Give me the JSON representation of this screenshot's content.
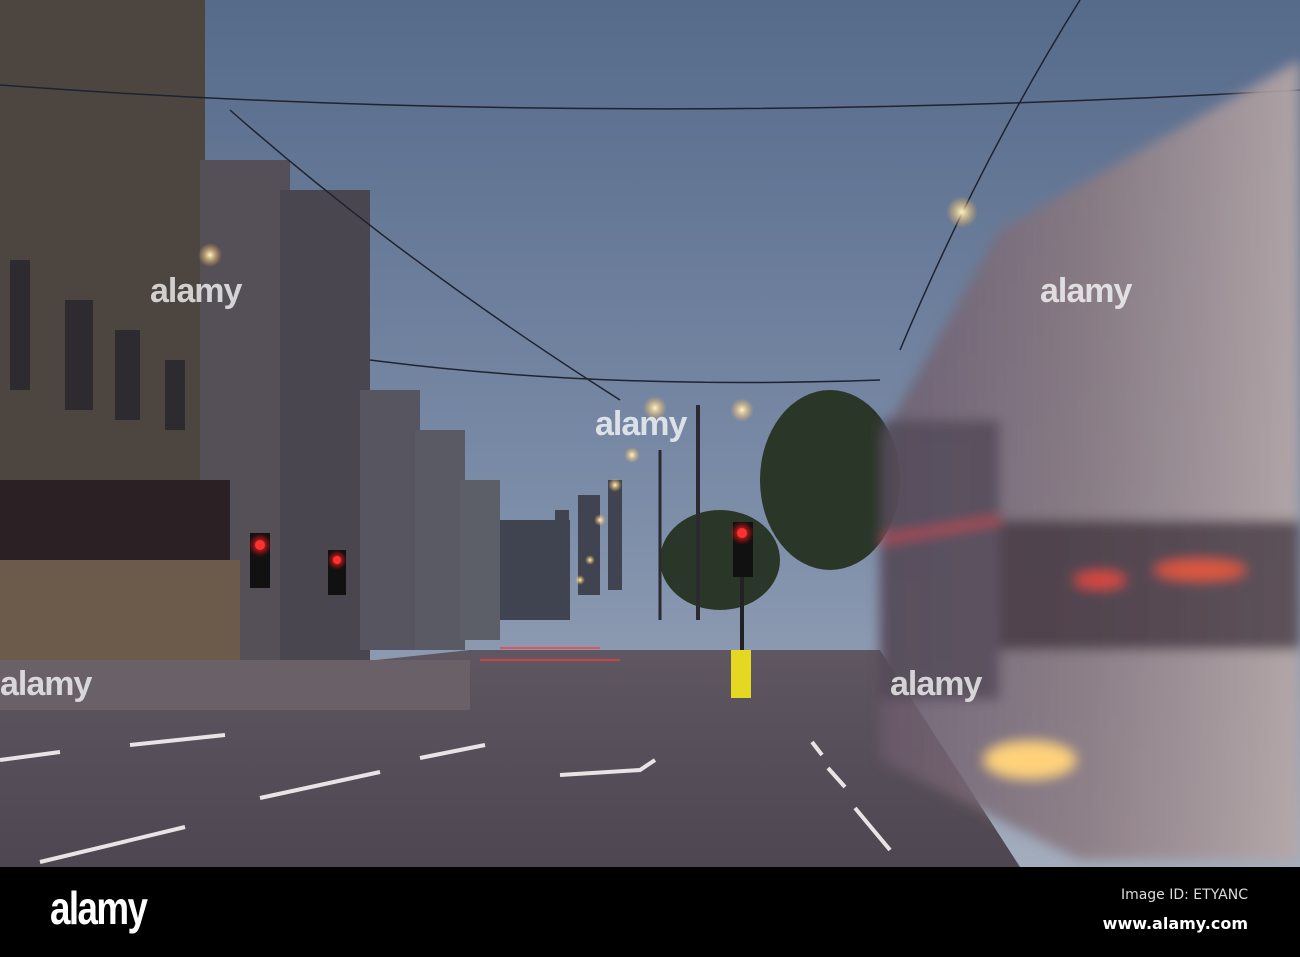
{
  "photo": {
    "subject": "city street at dusk with blurred double-decker bus",
    "colors": {
      "sky_top": "#5b6f8e",
      "sky_horizon": "#9aa6b8",
      "road": "#57505a",
      "signal_red": "#ff2020",
      "lamp": "#ffe6a0"
    }
  },
  "watermark": {
    "text": "alamy"
  },
  "footer": {
    "logo": "alamy",
    "image_id": "Image ID: ETYANC",
    "website": "www.alamy.com"
  }
}
